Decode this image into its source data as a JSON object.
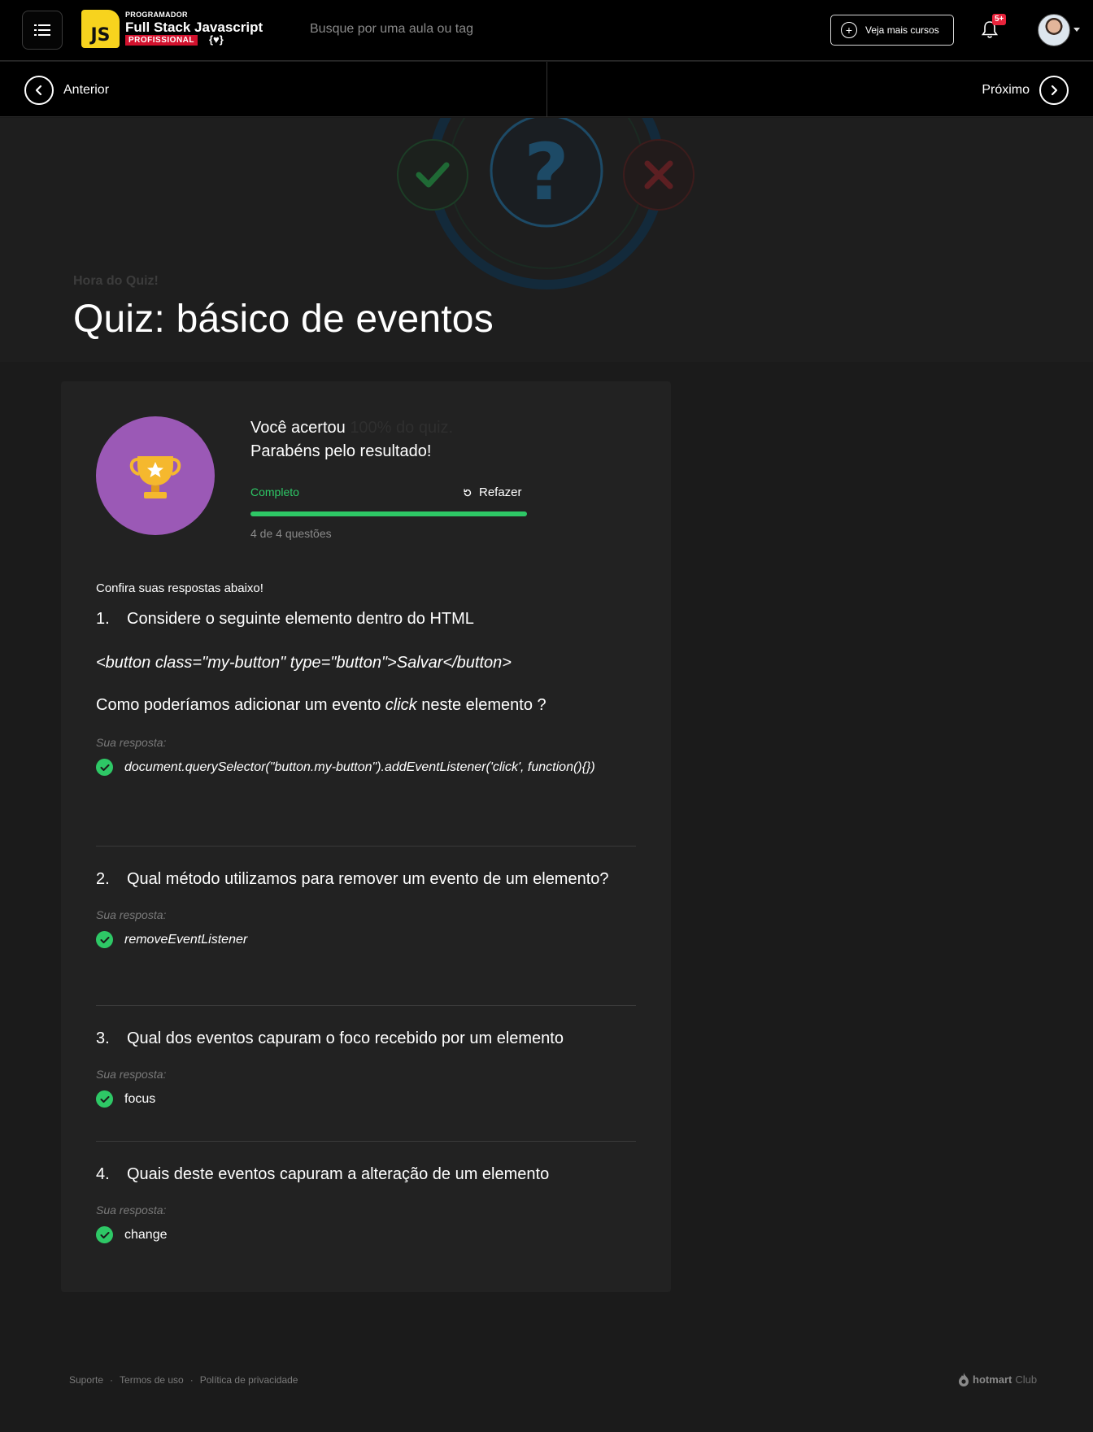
{
  "header": {
    "logo": {
      "badge": "JS",
      "top": "PROGRAMADOR",
      "main": "Full Stack Javascript",
      "pro": "PROFISSIONAL",
      "bracket": "{♥}"
    },
    "search_placeholder": "Busque por uma aula ou tag",
    "more_courses_label": "Veja mais cursos",
    "notifications_badge": "5+"
  },
  "nav": {
    "prev_label": "Anterior",
    "next_label": "Próximo"
  },
  "hero": {
    "subtitle": "Hora do Quiz!",
    "title": "Quiz: básico de eventos"
  },
  "result": {
    "line1": "Você acertou",
    "line1_dim": "100% do quiz.",
    "line2": "Parabéns pelo resultado!",
    "status": "Completo",
    "redo_label": "Refazer",
    "progress_fraction": 1.0,
    "count_text": "4 de 4 questões",
    "check_answers": "Confira suas respostas abaixo!"
  },
  "questions": [
    {
      "number": "1.",
      "title": "Considere o seguinte elemento dentro do HTML",
      "code": "<button class=\"my-button\" type=\"button\">Salvar</button>",
      "extra_before": "Como poderíamos adicionar um evento ",
      "extra_em": "click",
      "extra_after": " neste elemento ?",
      "answer_label": "Sua resposta:",
      "answer": "document.querySelector(\"button.my-button\").addEventListener('click', function(){})"
    },
    {
      "number": "2.",
      "title": "Qual método utilizamos para remover um evento de um elemento?",
      "answer_label": "Sua resposta:",
      "answer": "removeEventListener"
    },
    {
      "number": "3.",
      "title": "Qual dos eventos capuram o foco recebido por um elemento",
      "answer_label": "Sua resposta:",
      "answer": "focus"
    },
    {
      "number": "4.",
      "title": "Quais deste eventos capuram a alteração de um elemento",
      "answer_label": "Sua resposta:",
      "answer": "change"
    }
  ],
  "footer": {
    "links": [
      "Suporte",
      "Termos de uso",
      "Política de privacidade"
    ],
    "separator": "·",
    "brand": "hotmart",
    "brand_suffix": "Club"
  },
  "colors": {
    "success": "#2ec866",
    "trophy_bg": "#9b59b6",
    "trophy": "#f5b82e",
    "pro_badge": "#d3122e",
    "notify_badge": "#e8243c",
    "js_yellow": "#f7d31e"
  }
}
